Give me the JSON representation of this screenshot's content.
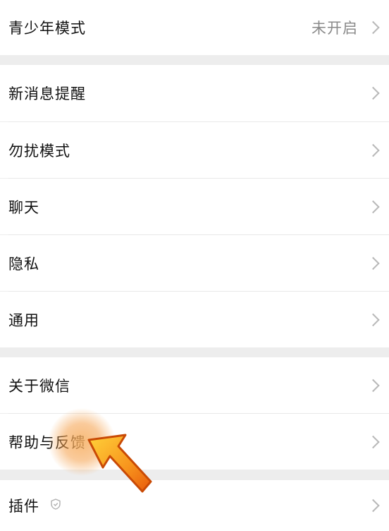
{
  "settings": {
    "teen_mode": {
      "label": "青少年模式",
      "value": "未开启",
      "icon": "chevron-right-icon"
    },
    "group1": [
      {
        "label": "新消息提醒",
        "icon": "chevron-right-icon"
      },
      {
        "label": "勿扰模式",
        "icon": "chevron-right-icon"
      },
      {
        "label": "聊天",
        "icon": "chevron-right-icon"
      },
      {
        "label": "隐私",
        "icon": "chevron-right-icon"
      },
      {
        "label": "通用",
        "icon": "chevron-right-icon"
      }
    ],
    "group2": [
      {
        "label": "关于微信",
        "icon": "chevron-right-icon"
      },
      {
        "label": "帮助与反馈",
        "icon": "chevron-right-icon"
      }
    ],
    "plugins": {
      "label": "插件",
      "badge_icon": "shield-icon",
      "icon": "chevron-right-icon"
    }
  },
  "overlay": {
    "icon": "pointer-arrow-icon",
    "highlight_color": "#f5a04a",
    "arrow_color": "#f07a12"
  }
}
